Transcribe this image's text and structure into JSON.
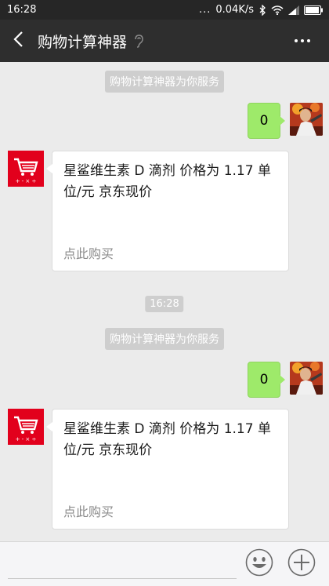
{
  "status_bar": {
    "time": "16:28",
    "dots": "...",
    "network_speed": "0.04K/s"
  },
  "header": {
    "title": "购物计算神器"
  },
  "messages": [
    {
      "system_notice": "购物计算神器为你服务"
    },
    {
      "user_message": "0"
    },
    {
      "bot_card": {
        "text": "星鲨维生素 D 滴剂 价格为 1.17 单位/元 京东现价",
        "link": "点此购买"
      }
    },
    {
      "time_stamp": "16:28"
    },
    {
      "system_notice": "购物计算神器为你服务"
    },
    {
      "user_message": "0"
    },
    {
      "bot_card": {
        "text": "星鲨维生素 D 滴剂 价格为 1.17 单位/元 京东现价",
        "link": "点此购买"
      }
    }
  ],
  "bot_logo": {
    "symbols": "+ - × ÷"
  },
  "colors": {
    "title_bar": "#2e2e2e",
    "user_bubble": "#9eea6a",
    "bot_logo": "#e2001c",
    "background": "#ebebeb"
  },
  "icons": {
    "back": "chevron-left-icon",
    "ear": "ear-icon",
    "more": "more-dots-icon",
    "emoji": "emoji-icon",
    "plus": "plus-icon"
  }
}
